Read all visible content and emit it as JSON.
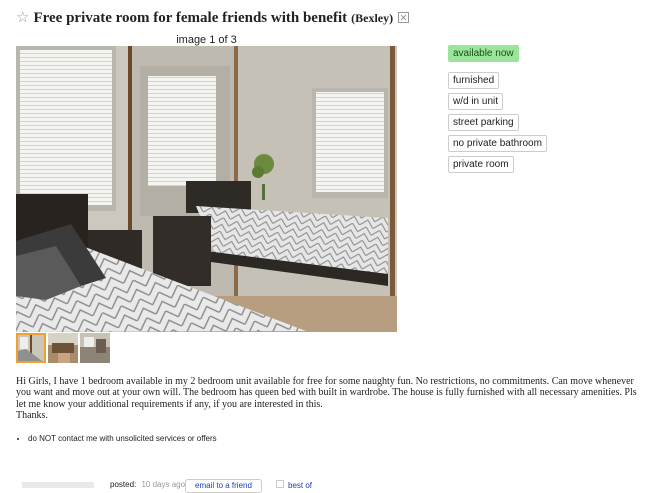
{
  "posting": {
    "star": "☆",
    "title": "Free private room for female friends with benefit",
    "location": "(Bexley)"
  },
  "gallery": {
    "counter": "image 1 of 3",
    "thumbnail_count": 3,
    "active_index": 0
  },
  "attributes": {
    "availability": "available now",
    "tags": [
      "furnished",
      "w/d in unit",
      "street parking",
      "no private bathroom",
      "private room"
    ]
  },
  "description": {
    "line1": "Hi Girls, I have 1 bedroom available in my 2 bedroom unit available for free for some naughty fun. No restrictions, no commitments. Can move whenever you want and move out at your own will. The bedroom has queen bed with built in wardrobe. The house is fully furnished with all necessary amenities. Pls let me know your additional requirements if any, if you are interested in this.",
    "line2": "Thanks."
  },
  "notices": [
    "do NOT contact me with unsolicited services or offers"
  ],
  "footer": {
    "posted_label": "posted:",
    "posted_ago": "10 days ago",
    "email_label": "email to a friend",
    "best_of_label": "best of"
  },
  "colors": {
    "availability_bg": "#9be59b",
    "active_thumb_border": "#f0a030",
    "link": "#1a3fb4"
  }
}
